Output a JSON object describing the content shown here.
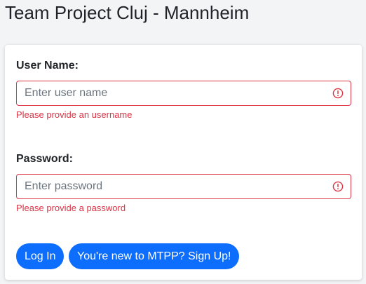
{
  "header": {
    "title": "Team Project Cluj - Mannheim"
  },
  "form": {
    "username": {
      "label": "User Name:",
      "placeholder": "Enter user name",
      "value": "",
      "error": "Please provide an username",
      "icon": "error-alert-icon"
    },
    "password": {
      "label": "Password:",
      "placeholder": "Enter password",
      "value": "",
      "error": "Please provide a password",
      "icon": "error-alert-icon"
    },
    "buttons": {
      "login_label": "Log In",
      "signup_label": "You're new to MTPP? Sign Up!"
    }
  },
  "colors": {
    "primary": "#0d6efd",
    "danger": "#dc3545",
    "background": "#f3f4f6",
    "card": "#ffffff"
  }
}
